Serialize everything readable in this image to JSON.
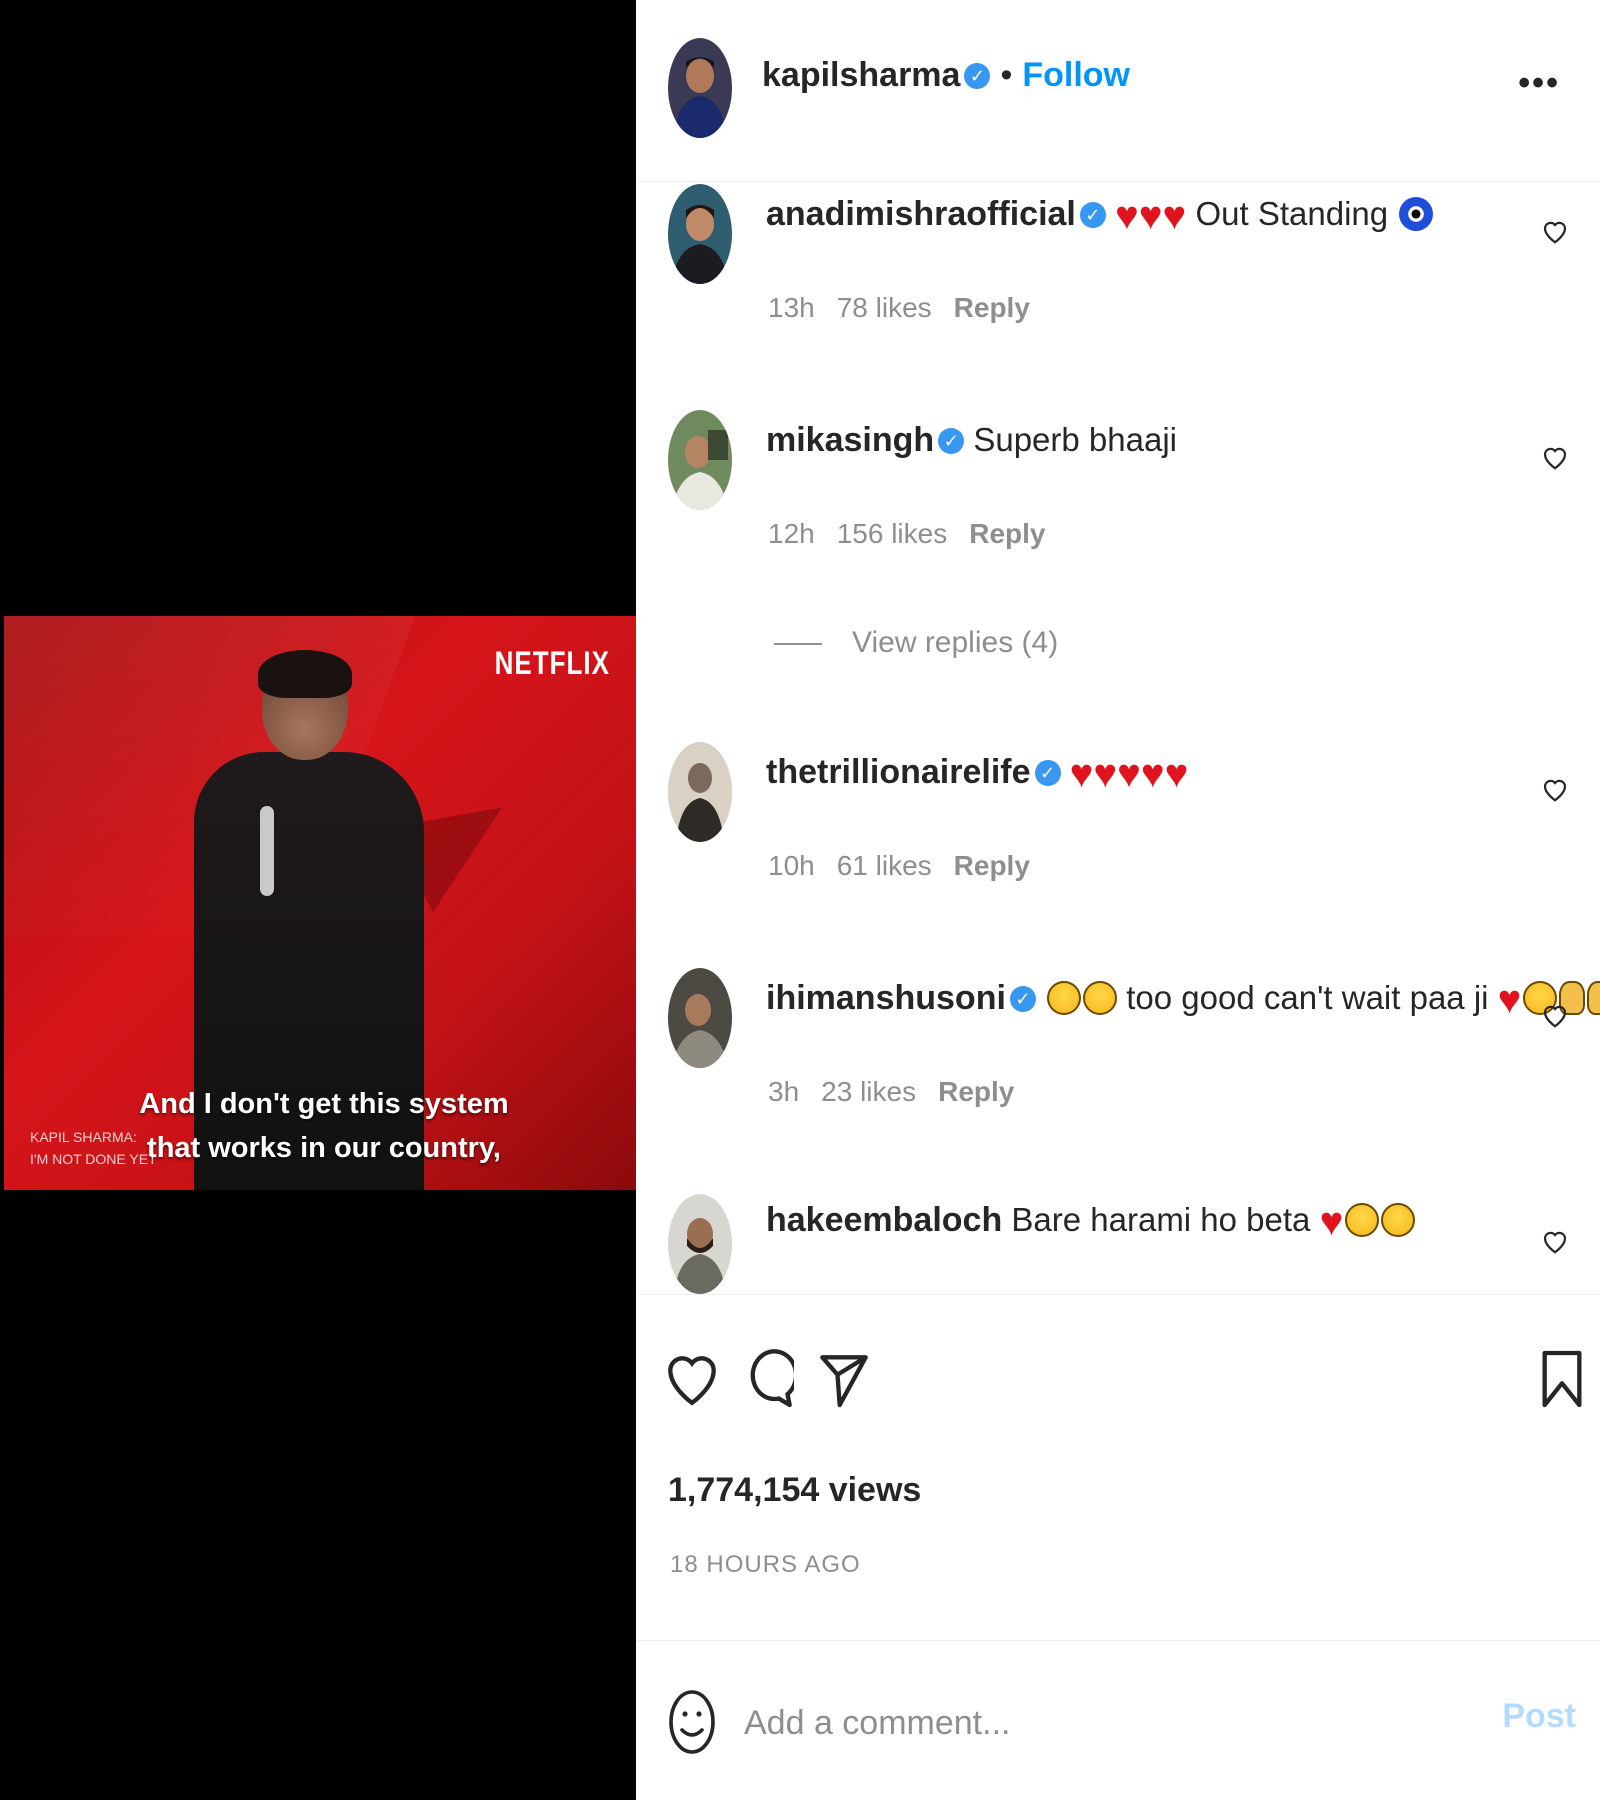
{
  "video": {
    "brand": "NETFLIX",
    "caption_line1": "And I don't get this system",
    "caption_line2": "that works in our country,",
    "watermark_line1": "KAPIL SHARMA:",
    "watermark_line2": "I'M NOT DONE YET"
  },
  "header": {
    "username": "kapilsharma",
    "separator": "•",
    "follow_label": "Follow",
    "more_label": "•••"
  },
  "comments": [
    {
      "username": "anadimishraofficial",
      "text": "Out Standing",
      "time": "13h",
      "likes": "78 likes",
      "reply": "Reply",
      "emojis_before": "♥♥♥",
      "emoji_after": "nazar"
    },
    {
      "username": "mikasingh",
      "text": "Superb bhaaji",
      "time": "12h",
      "likes": "156 likes",
      "reply": "Reply",
      "view_replies": "View replies (4)"
    },
    {
      "username": "thetrillionairelife",
      "text": "",
      "time": "10h",
      "likes": "61 likes",
      "reply": "Reply",
      "emojis_before": "♥♥♥♥♥"
    },
    {
      "username": "ihimanshusoni",
      "text": "too good can't wait paa ji",
      "time": "3h",
      "likes": "23 likes",
      "reply": "Reply",
      "emojis_after": "♥"
    },
    {
      "username": "hakeembaloch",
      "text": "Bare harami ho beta",
      "emojis_after": "♥"
    }
  ],
  "stats": {
    "views": "1,774,154 views",
    "time_ago": "18 HOURS AGO"
  },
  "add_comment": {
    "placeholder": "Add a comment...",
    "post_label": "Post"
  },
  "colors": {
    "accent": "#0095f6",
    "verified": "#3897f0",
    "muted": "#8e8e8e",
    "post_disabled": "#b3dbff",
    "heart": "#e0141e"
  }
}
